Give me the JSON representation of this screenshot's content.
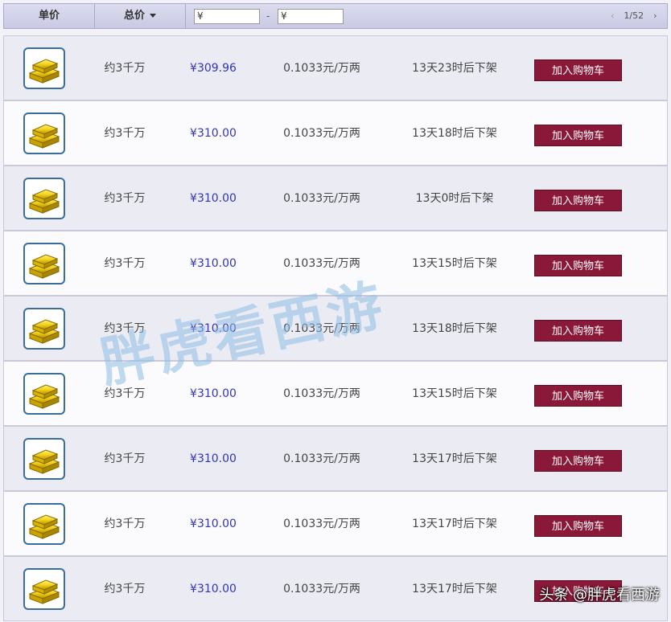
{
  "header": {
    "unit_price_label": "单价",
    "total_price_label": "总价",
    "min_price_value": "¥",
    "max_price_value": "¥",
    "dash": "-",
    "prev_arrow": "‹",
    "page_indicator": "1/52",
    "next_arrow": "›"
  },
  "rows": [
    {
      "amount": "约3千万",
      "total": "¥309.96",
      "unit_price": "0.1033元/万两",
      "time_left": "13天23时后下架",
      "button": "加入购物车"
    },
    {
      "amount": "约3千万",
      "total": "¥310.00",
      "unit_price": "0.1033元/万两",
      "time_left": "13天18时后下架",
      "button": "加入购物车"
    },
    {
      "amount": "约3千万",
      "total": "¥310.00",
      "unit_price": "0.1033元/万两",
      "time_left": "13天0时后下架",
      "button": "加入购物车"
    },
    {
      "amount": "约3千万",
      "total": "¥310.00",
      "unit_price": "0.1033元/万两",
      "time_left": "13天15时后下架",
      "button": "加入购物车"
    },
    {
      "amount": "约3千万",
      "total": "¥310.00",
      "unit_price": "0.1033元/万两",
      "time_left": "13天18时后下架",
      "button": "加入购物车"
    },
    {
      "amount": "约3千万",
      "total": "¥310.00",
      "unit_price": "0.1033元/万两",
      "time_left": "13天15时后下架",
      "button": "加入购物车"
    },
    {
      "amount": "约3千万",
      "total": "¥310.00",
      "unit_price": "0.1033元/万两",
      "time_left": "13天17时后下架",
      "button": "加入购物车"
    },
    {
      "amount": "约3千万",
      "total": "¥310.00",
      "unit_price": "0.1033元/万两",
      "time_left": "13天17时后下架",
      "button": "加入购物车"
    },
    {
      "amount": "约3千万",
      "total": "¥310.00",
      "unit_price": "0.1033元/万两",
      "time_left": "13天17时后下架",
      "button": "加入购物车"
    }
  ],
  "watermark": "胖虎看西游",
  "credit": "头条 @胖虎看西游",
  "colors": {
    "accent_button": "#8a1838",
    "price_text": "#3333bb",
    "icon_border": "#3b6d9c"
  },
  "item_icon": "gold-bars-icon"
}
